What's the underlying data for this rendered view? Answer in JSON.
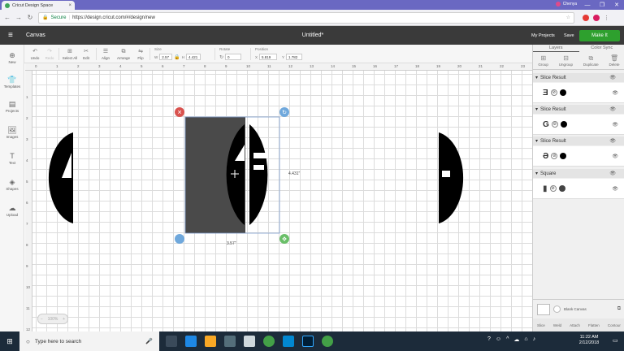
{
  "browser": {
    "tab_title": "Cricut Design Space",
    "tab_close": "×",
    "user_name": "Chenya",
    "secure_label": "Secure",
    "url": "https://design.cricut.com/#/design/new",
    "window_controls": [
      "—",
      "❐",
      "✕"
    ]
  },
  "app": {
    "title": "Canvas",
    "doc_title": "Untitled*",
    "my_projects": "My Projects",
    "save": "Save",
    "make_it": "Make It"
  },
  "toolbar": {
    "undo": "Undo",
    "redo": "Redo",
    "select_all": "Select All",
    "edit": "Edit",
    "align": "Align",
    "arrange": "Arrange",
    "flip": "Flip",
    "size_label": "Size",
    "w_label": "W",
    "w_value": "2.57",
    "h_label": "H",
    "h_value": "4.421",
    "rotate_label": "Rotate",
    "rotate_value": "0",
    "position_label": "Position",
    "x_label": "X",
    "x_value": "5.819",
    "y_label": "Y",
    "y_value": "1.782"
  },
  "leftnav": [
    {
      "label": "New",
      "icon": "plus-icon"
    },
    {
      "label": "Templates",
      "icon": "shirt-icon"
    },
    {
      "label": "Projects",
      "icon": "projects-icon"
    },
    {
      "label": "Images",
      "icon": "images-icon"
    },
    {
      "label": "Text",
      "icon": "text-icon"
    },
    {
      "label": "Shapes",
      "icon": "shapes-icon"
    },
    {
      "label": "Upload",
      "icon": "upload-icon"
    }
  ],
  "rulers": {
    "top": [
      "0",
      "1",
      "2",
      "3",
      "4",
      "5",
      "6",
      "7",
      "8",
      "9",
      "10",
      "11",
      "12",
      "13",
      "14",
      "15",
      "16",
      "17",
      "18",
      "19",
      "20",
      "21",
      "22",
      "23"
    ],
    "left": [
      "1",
      "2",
      "3",
      "4",
      "5",
      "6",
      "7",
      "8",
      "9",
      "10",
      "11",
      "12"
    ]
  },
  "canvas": {
    "letter_left": "A",
    "letter_mid": "AF",
    "letter_right": "G",
    "width_dim": "3.57\"",
    "height_dim": "4.431\""
  },
  "zoom": {
    "minus": "−",
    "level": "100%",
    "plus": "+"
  },
  "panel": {
    "tabs": [
      "Layers",
      "Color Sync"
    ],
    "actions": [
      "Group",
      "Ungroup",
      "Duplicate",
      "Delete"
    ],
    "layers": [
      {
        "name": "Slice Result",
        "glyph": "Ǝ"
      },
      {
        "name": "Slice Result",
        "glyph": "G"
      },
      {
        "name": "Slice Result",
        "glyph": "Ə"
      },
      {
        "name": "Square",
        "glyph": "▮"
      }
    ],
    "blank_canvas": "Blank Canvas",
    "bottom_tools": [
      "Slice",
      "Weld",
      "Attach",
      "Flatten",
      "Contour"
    ]
  },
  "taskbar": {
    "search_placeholder": "Type here to search",
    "time": "11:22 AM",
    "date": "2/12/2018"
  },
  "colors": {
    "accent": "#2ea02e",
    "brand_bar": "#3a3a3a",
    "chrome": "#6a68c2",
    "selection": "#4a4a4a",
    "taskbar": "#1c2b3a"
  }
}
